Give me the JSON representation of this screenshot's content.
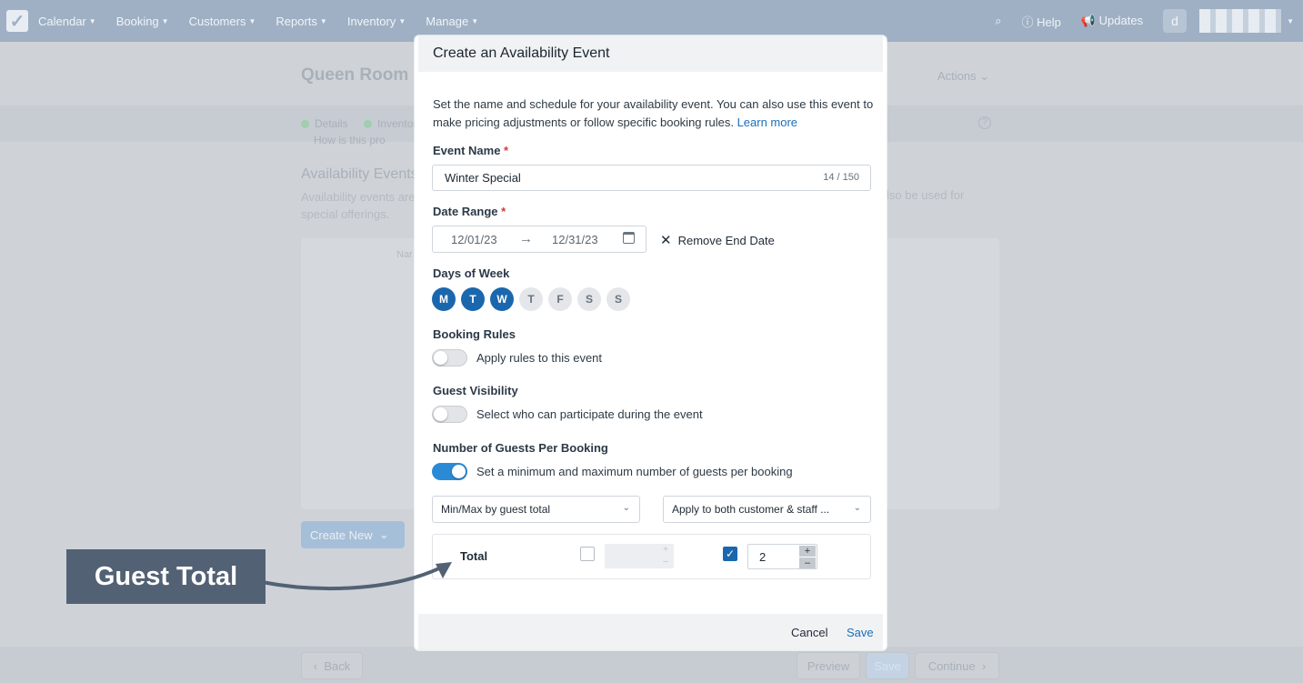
{
  "topbar": {
    "nav": [
      {
        "label": "Calendar"
      },
      {
        "label": "Booking"
      },
      {
        "label": "Customers"
      },
      {
        "label": "Reports"
      },
      {
        "label": "Inventory"
      },
      {
        "label": "Manage"
      }
    ],
    "help_label": "Help",
    "updates_label": "Updates",
    "avatar_initial": "d"
  },
  "background": {
    "page_title": "Queen Room",
    "actions_label": "Actions",
    "steps": [
      "Details",
      "Inventor"
    ],
    "help_text_fragment": "How is this pro",
    "section_title": "Availability Events",
    "section_desc": "Availability events are special offerings.",
    "section_desc_right": "lso be used for",
    "column_header": "Nar",
    "create_new_label": "Create New",
    "back_label": "Back",
    "preview_label": "Preview",
    "save_label": "Save",
    "continue_label": "Continue"
  },
  "modal": {
    "title": "Create an Availability Event",
    "intro_text": "Set the name and schedule for your availability event. You can also use this event to make pricing adjustments or follow specific booking rules.",
    "learn_more": "Learn more",
    "event_name_label": "Event Name",
    "event_name_value": "Winter Special",
    "event_name_counter": "14 / 150",
    "date_range_label": "Date Range",
    "date_start": "12/01/23",
    "date_end": "12/31/23",
    "remove_end_date": "Remove End Date",
    "days_label": "Days of Week",
    "days": [
      {
        "letter": "M",
        "selected": true
      },
      {
        "letter": "T",
        "selected": true
      },
      {
        "letter": "W",
        "selected": true
      },
      {
        "letter": "T",
        "selected": false
      },
      {
        "letter": "F",
        "selected": false
      },
      {
        "letter": "S",
        "selected": false
      },
      {
        "letter": "S",
        "selected": false
      }
    ],
    "booking_rules_label": "Booking Rules",
    "booking_rules_toggle": "Apply rules to this event",
    "booking_rules_on": false,
    "guest_visibility_label": "Guest Visibility",
    "guest_visibility_toggle": "Select who can participate during the event",
    "guest_visibility_on": false,
    "guests_per_booking_label": "Number of Guests Per Booking",
    "guests_per_booking_toggle": "Set a minimum and maximum number of guests per booking",
    "guests_per_booking_on": true,
    "minmax_select": "Min/Max by guest total",
    "apply_select": "Apply to both customer & staff ...",
    "total_label": "Total",
    "min_enabled": false,
    "max_enabled": true,
    "max_value": "2",
    "cancel_label": "Cancel",
    "save_label": "Save"
  },
  "callout": {
    "text": "Guest Total"
  },
  "colors": {
    "accent": "#1b67ad",
    "link": "#1a6fb8",
    "required": "#d33a3a",
    "callout_bg": "#536174"
  }
}
